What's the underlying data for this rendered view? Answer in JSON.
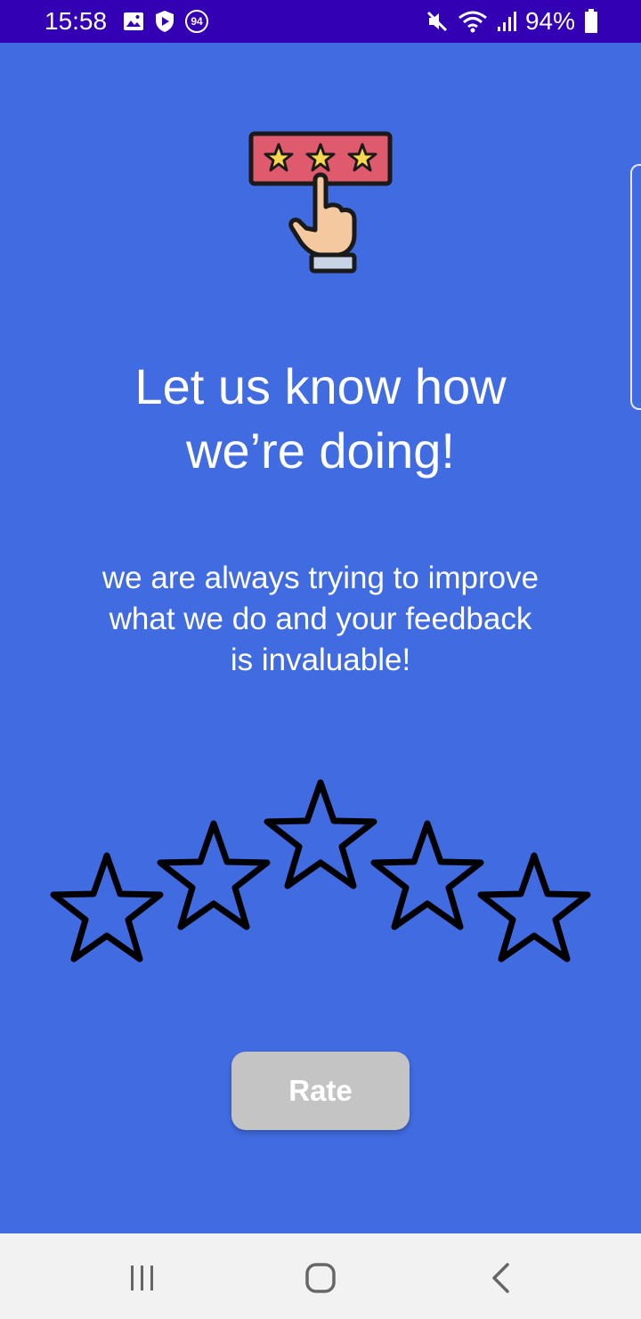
{
  "status_bar": {
    "time": "15:58",
    "battery_percent": "94%",
    "notification_icons": [
      "gallery-icon",
      "shield-icon",
      "badge-94-icon"
    ],
    "notification_badge": "94",
    "system_icons": [
      "mute-icon",
      "wifi-icon",
      "signal-icon",
      "battery-icon"
    ]
  },
  "content": {
    "headline": "Let us know how\nwe’re doing!",
    "subtext": "we are always trying to improve\nwhat we do and your feedback\nis invaluable!",
    "rating": {
      "max_stars": 5,
      "selected": 0
    },
    "rate_label": "Rate"
  },
  "navigation": {
    "buttons": [
      "recent-apps-icon",
      "home-icon",
      "back-icon"
    ]
  },
  "colors": {
    "status_bar": "#3300b3",
    "background": "#416be0",
    "button_disabled": "#c4c4c4",
    "nav_bar": "#f2f2f2"
  }
}
